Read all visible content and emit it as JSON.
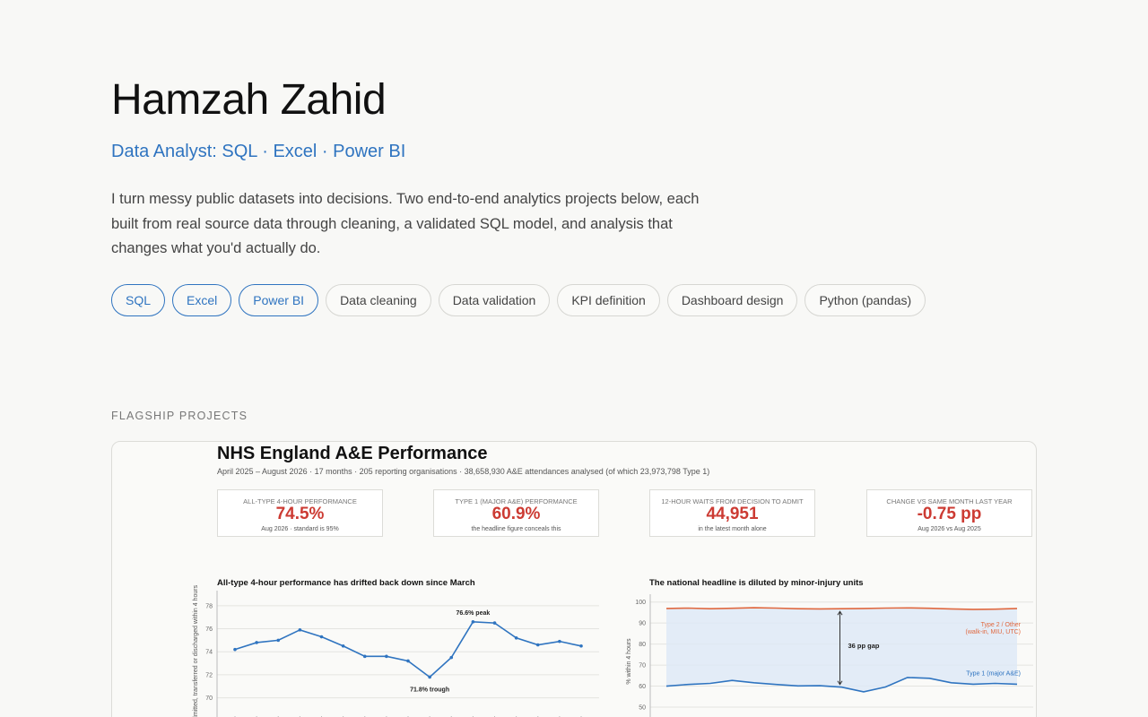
{
  "header": {
    "name": "Hamzah Zahid",
    "tagline": "Data Analyst: SQL · Excel · Power BI",
    "intro": "I turn messy public datasets into decisions. Two end-to-end analytics projects below, each built from real source data through cleaning, a validated SQL model, and analysis that changes what you'd actually do."
  },
  "skills": [
    {
      "label": "SQL",
      "primary": true
    },
    {
      "label": "Excel",
      "primary": true
    },
    {
      "label": "Power BI",
      "primary": true
    },
    {
      "label": "Data cleaning",
      "primary": false
    },
    {
      "label": "Data validation",
      "primary": false
    },
    {
      "label": "KPI definition",
      "primary": false
    },
    {
      "label": "Dashboard design",
      "primary": false
    },
    {
      "label": "Python (pandas)",
      "primary": false
    }
  ],
  "projects": {
    "section_label": "FLAGSHIP PROJECTS",
    "card": {
      "title": "NHS England A&E Performance",
      "subtitle": "April 2025 – August 2026  ·  17 months  ·  205 reporting organisations  ·  38,658,930 A&E attendances analysed  (of which 23,973,798 Type 1)",
      "kpis": [
        {
          "label": "ALL-TYPE 4-HOUR PERFORMANCE",
          "value": "74.5%",
          "note": "Aug 2026  ·  standard is 95%"
        },
        {
          "label": "TYPE 1 (MAJOR A&E) PERFORMANCE",
          "value": "60.9%",
          "note": "the headline figure conceals this"
        },
        {
          "label": "12-HOUR WAITS FROM DECISION TO ADMIT",
          "value": "44,951",
          "note": "in the latest month alone"
        },
        {
          "label": "CHANGE VS SAME MONTH LAST YEAR",
          "value": "-0.75 pp",
          "note": "Aug 2026 vs Aug 2025"
        }
      ],
      "left_panel_title": "All-type 4-hour performance has drifted back down since March",
      "right_panel_title": "The national headline is diluted by minor-injury units"
    }
  },
  "colors": {
    "accent": "#2f74c0",
    "kpi_red": "#cc3b33",
    "type2_orange": "#e0683f"
  },
  "chart_data": [
    {
      "type": "line",
      "title": "All-type 4-hour performance has drifted back down since March",
      "ylabel": "% admitted, transferred or discharged within 4 hours",
      "ylim": [
        69.5,
        79
      ],
      "yticks": [
        70,
        72,
        74,
        76,
        78
      ],
      "grid": true,
      "series": [
        {
          "name": "",
          "color": "#2f74c0",
          "values": [
            74.2,
            74.8,
            75.0,
            75.9,
            75.3,
            74.5,
            73.6,
            73.6,
            73.2,
            71.8,
            73.5,
            76.6,
            76.5,
            75.2,
            74.6,
            74.9,
            74.5
          ]
        }
      ],
      "annotations": [
        {
          "text": "76.6%  peak",
          "index": 11,
          "value": 76.6
        },
        {
          "text": "71.8%  trough",
          "index": 9,
          "value": 71.8
        }
      ]
    },
    {
      "type": "line",
      "title": "The national headline is diluted by minor-injury units",
      "ylabel": "% within 4 hours",
      "ylim": [
        50,
        102
      ],
      "yticks": [
        50,
        60,
        70,
        80,
        90,
        100
      ],
      "grid": true,
      "series": [
        {
          "name": "Type 2 / Other (walk-in, MIU, UTC)",
          "color": "#e0683f",
          "values": [
            96.9,
            97.1,
            96.8,
            97.0,
            97.3,
            97.1,
            96.8,
            96.7,
            96.8,
            96.9,
            97.1,
            97.2,
            97.0,
            96.7,
            96.5,
            96.6,
            96.9
          ]
        },
        {
          "name": "Type 1 (major A&E)",
          "color": "#2f74c0",
          "values": [
            60.0,
            60.8,
            61.3,
            62.7,
            61.6,
            60.8,
            60.1,
            60.2,
            59.5,
            57.3,
            59.6,
            64.1,
            63.7,
            61.6,
            60.9,
            61.3,
            60.9
          ]
        }
      ],
      "annotations": [
        {
          "text": "36 pp gap",
          "index": 8
        }
      ]
    }
  ]
}
